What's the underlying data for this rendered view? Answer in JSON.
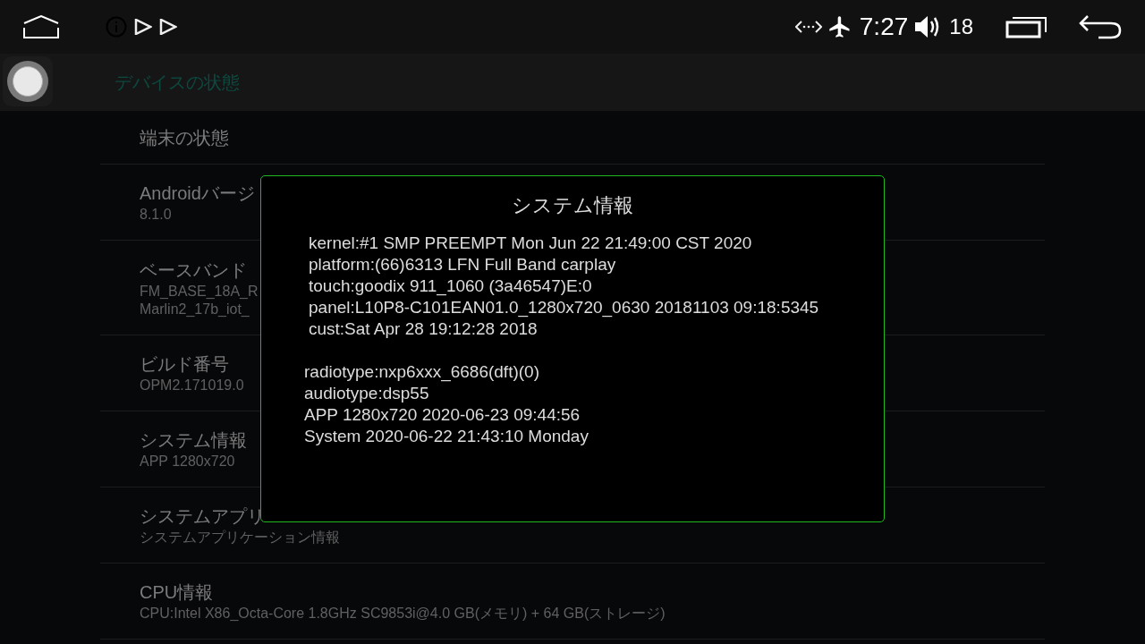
{
  "status_bar": {
    "time": "7:27",
    "volume": "18"
  },
  "header": {
    "title": "デバイスの状態"
  },
  "settings": [
    {
      "title": "端末の状態"
    },
    {
      "title": "Androidバージ",
      "summary": [
        "8.1.0"
      ]
    },
    {
      "title": "ベースバンド",
      "summary": [
        "FM_BASE_18A_R",
        "Marlin2_17b_iot_"
      ]
    },
    {
      "title": "ビルド番号",
      "summary": [
        "OPM2.171019.0"
      ]
    },
    {
      "title": "システム情報",
      "summary": [
        "APP 1280x720"
      ]
    },
    {
      "title": "システムアプリ",
      "summary": [
        "システムアプリケーション情報"
      ]
    },
    {
      "title": "CPU情報",
      "summary": [
        "CPU:Intel X86_Octa-Core 1.8GHz SC9853i@4.0 GB(メモリ) + 64 GB(ストレージ)"
      ]
    }
  ],
  "dialog": {
    "title": "システム情報",
    "blocks": [
      [
        "kernel:#1 SMP PREEMPT Mon Jun 22 21:49:00 CST 2020",
        "platform:(66)6313 LFN Full Band carplay",
        "touch:goodix 911_1060 (3a46547)E:0",
        "panel:L10P8-C101EAN01.0_1280x720_0630 20181103 09:18:5345",
        "cust:Sat Apr 28 19:12:28 2018"
      ],
      [
        "radiotype:nxp6xxx_6686(dft)(0)",
        "audiotype:dsp55",
        "APP 1280x720 2020-06-23 09:44:56",
        "System 2020-06-22 21:43:10 Monday"
      ]
    ]
  }
}
